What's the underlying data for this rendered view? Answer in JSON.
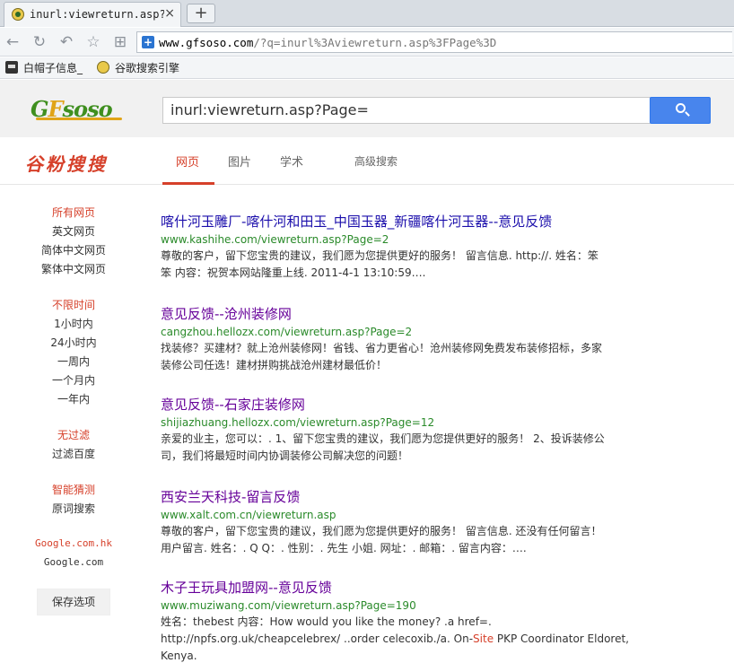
{
  "browser": {
    "tab_title": "inurl:viewreturn.asp?Page",
    "tab_close": "×",
    "new_tab": "+",
    "url_host": "www.gfsoso.com",
    "url_rest": "/?q=inurl%3Aviewreturn.asp%3FPage%3D",
    "bookmarks": [
      "白帽子信息_",
      "谷歌搜索引擎"
    ]
  },
  "header": {
    "logo_g": "G",
    "logo_f": "F",
    "logo_rest": "soso",
    "search_value": "inurl:viewreturn.asp?Page="
  },
  "subnav": {
    "brand": "谷粉搜搜",
    "tabs": [
      "网页",
      "图片",
      "学术",
      "高级搜索"
    ]
  },
  "sidebar": {
    "all_pages": "所有网页",
    "english": "英文网页",
    "simplified": "简体中文网页",
    "traditional": "繁体中文网页",
    "any_time": "不限时间",
    "hour": "1小时内",
    "day": "24小时内",
    "week": "一周内",
    "month": "一个月内",
    "year": "一年内",
    "no_filter": "无过滤",
    "filter_baidu": "过滤百度",
    "smart_guess": "智能猜测",
    "verbatim": "原词搜索",
    "google_hk": "Google.com.hk",
    "google_com": "Google.com",
    "save": "保存选项"
  },
  "results": [
    {
      "title": "喀什河玉雕厂-喀什河和田玉_中国玉器_新疆喀什河玉器--意见反馈",
      "url": "www.kashihe.com/viewreturn.asp?Page=2",
      "snippet_1": "尊敬的客户，留下您宝贵的建议，我们愿为您提供更好的服务！ 留言信息. http://. 姓名：笨",
      "snippet_2": "笨 内容：祝贺本网站隆重上线. 2011-4-1 13:10:59…."
    },
    {
      "title": "意见反馈--沧州装修网",
      "url": "cangzhou.hellozx.com/viewreturn.asp?Page=2",
      "snippet_1": "找装修？买建材？就上沧州装修网！省钱、省力更省心！沧州装修网免费发布装修招标，多家",
      "snippet_2": "装修公司任选！建材拼购挑战沧州建材最低价！"
    },
    {
      "title": "意见反馈--石家庄装修网",
      "url": "shijiazhuang.hellozx.com/viewreturn.asp?Page=12",
      "snippet_1": "亲爱的业主，您可以：. 1、留下您宝贵的建议，我们愿为您提供更好的服务！ 2、投诉装修公",
      "snippet_2": "司，我们将最短时间内协调装修公司解决您的问题！"
    },
    {
      "title": "西安兰天科技-留言反馈",
      "url": "www.xalt.com.cn/viewreturn.asp",
      "snippet_1": "尊敬的客户，留下您宝贵的建议，我们愿为您提供更好的服务！ 留言信息. 还没有任何留言！",
      "snippet_2": "用户留言. 姓名：. Q Q：. 性别：. 先生 小姐. 网址：. 邮箱：. 留言内容：…."
    },
    {
      "title": "木子王玩具加盟网--意见反馈",
      "url": "www.muziwang.com/viewreturn.asp?Page=190",
      "snippet_1": "姓名：thebest 内容：How would you like the money? .a href=.",
      "snippet_2a": "http://npfs.org.uk/cheapcelebrex/ ..order celecoxib./a. On-",
      "snippet_2b": "Site",
      "snippet_2c": " PKP Coordinator Eldoret,",
      "snippet_3": "Kenya."
    }
  ]
}
